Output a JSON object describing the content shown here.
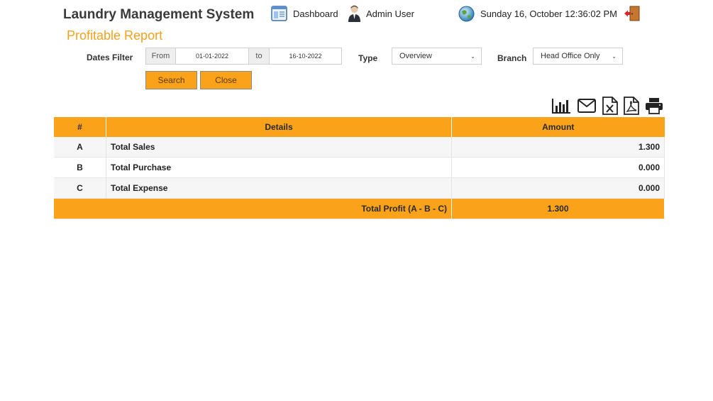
{
  "header": {
    "app_title": "Laundry Management System",
    "dashboard_label": "Dashboard",
    "user_label": "Admin User",
    "datetime": "Sunday 16, October 12:36:02 PM"
  },
  "report": {
    "title": "Profitable Report"
  },
  "filters": {
    "dates_label": "Dates Filter",
    "from_label": "From",
    "from_value": "01-01-2022",
    "to_label": "to",
    "to_value": "16-10-2022",
    "type_label": "Type",
    "type_value": "Overview",
    "branch_label": "Branch",
    "branch_value": "Head Office Only"
  },
  "buttons": {
    "search": "Search",
    "close": "Close"
  },
  "toolbar": {
    "icons": [
      "chart-icon",
      "email-icon",
      "excel-icon",
      "pdf-icon",
      "print-icon"
    ]
  },
  "table": {
    "headers": {
      "num": "#",
      "details": "Details",
      "amount": "Amount"
    },
    "rows": [
      {
        "num": "A",
        "details": "Total Sales",
        "amount": "1.300"
      },
      {
        "num": "B",
        "details": "Total Purchase",
        "amount": "0.000"
      },
      {
        "num": "C",
        "details": "Total Expense",
        "amount": "0.000"
      }
    ],
    "total": {
      "label": "Total Profit  (A - B - C)",
      "amount": "1.300"
    }
  },
  "colors": {
    "accent": "#faa31a",
    "title_orange": "#f5a11f"
  }
}
